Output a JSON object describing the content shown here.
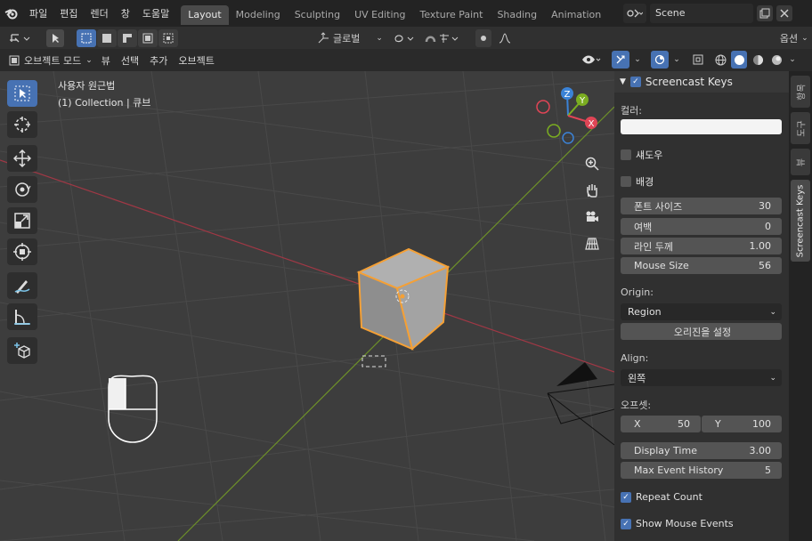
{
  "topbar": {
    "menu": [
      "파일",
      "편집",
      "렌더",
      "창",
      "도움말"
    ],
    "tabs": [
      "Layout",
      "Modeling",
      "Sculpting",
      "UV Editing",
      "Texture Paint",
      "Shading",
      "Animation"
    ],
    "active_tab": "Layout",
    "scene_name": "Scene"
  },
  "header1": {
    "orientation": "글로벌",
    "options": "옵션"
  },
  "header2": {
    "mode": "오브젝트 모드",
    "menus": [
      "뷰",
      "선택",
      "추가",
      "오브젝트"
    ]
  },
  "viewport": {
    "title": "사용자 원근법",
    "subtitle": "(1) Collection | 큐브",
    "gizmo_axes": [
      "X",
      "Y",
      "Z"
    ]
  },
  "panel": {
    "title": "Screencast Keys",
    "color_label": "컬러:",
    "shadow_label": "섀도우",
    "background_label": "배경",
    "font_size_label": "폰트 사이즈",
    "font_size_value": "30",
    "margin_label": "여백",
    "margin_value": "0",
    "line_width_label": "라인 두께",
    "line_width_value": "1.00",
    "mouse_size_label": "Mouse Size",
    "mouse_size_value": "56",
    "origin_label": "Origin:",
    "origin_value": "Region",
    "set_origin_label": "오리진을 설정",
    "align_label": "Align:",
    "align_value": "왼쪽",
    "offset_label": "오프셋:",
    "offset_x_label": "X",
    "offset_x_value": "50",
    "offset_y_label": "Y",
    "offset_y_value": "100",
    "display_time_label": "Display Time",
    "display_time_value": "3.00",
    "max_history_label": "Max Event History",
    "max_history_value": "5",
    "repeat_count_label": "Repeat Count",
    "show_mouse_label": "Show Mouse Events"
  },
  "vtabs": [
    "항목",
    "도구",
    "뷰",
    "Screencast Keys"
  ],
  "colors": {
    "accent": "#4772b3",
    "x_axis": "#e04556",
    "y_axis": "#7bad21",
    "z_axis": "#3b83d7",
    "selection": "#f5a035"
  }
}
